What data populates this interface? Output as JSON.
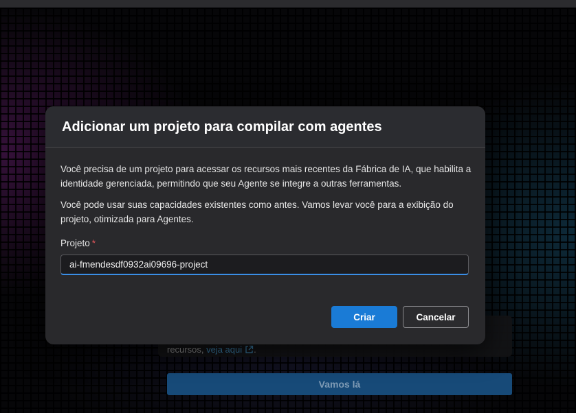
{
  "background": {
    "text_prefix": "recursos, ",
    "link_text": "veja aqui",
    "text_suffix": ".",
    "primary_button": "Vamos lá"
  },
  "dialog": {
    "title": "Adicionar um projeto para compilar com agentes",
    "paragraph1": "Você precisa de um projeto para acessar os recursos mais recentes da Fábrica de IA, que habilita a identidade gerenciada, permitindo que seu Agente se integre a outras ferramentas.",
    "paragraph2": "Você pode usar suas capacidades existentes como antes. Vamos levar você para a exibição do projeto, otimizada para Agentes.",
    "field": {
      "label": "Projeto",
      "required_mark": "*",
      "value": "ai-fmendesdf0932ai09696-project"
    },
    "buttons": {
      "create": "Criar",
      "cancel": "Cancelar"
    }
  },
  "colors": {
    "accent": "#1a7bd6",
    "required": "#e0555a",
    "link": "#3b7ea8"
  },
  "icons": {
    "external_link": "external-link-icon"
  }
}
